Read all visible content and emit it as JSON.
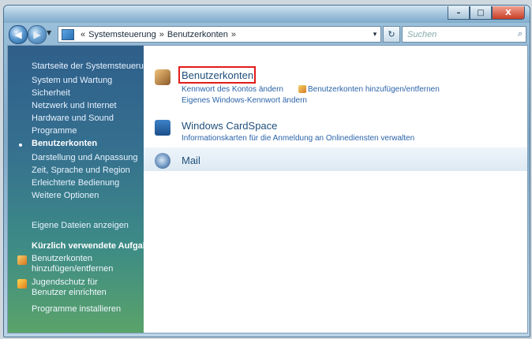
{
  "window": {
    "controls": {
      "minimize": "–",
      "maximize": "□",
      "close": "X"
    }
  },
  "address": {
    "sep1": "«",
    "crumb1": "Systemsteuerung",
    "sep2": "»",
    "crumb2": "Benutzerkonten",
    "sep3": "»",
    "dropdown": "▾",
    "refresh": "↻",
    "search_placeholder": "Suchen",
    "search_icon": "⌕"
  },
  "sidebar": {
    "top_links": [
      "Startseite der Systemsteuerung",
      "System und Wartung",
      "Sicherheit",
      "Netzwerk und Internet",
      "Hardware und Sound",
      "Programme",
      "Benutzerkonten",
      "Darstellung und Anpassung",
      "Zeit, Sprache und Region",
      "Erleichterte Bedienung",
      "Weitere Optionen"
    ],
    "active_index": 6,
    "recent_label": "Kürzlich verwendete Aufgaben",
    "tasks": [
      {
        "text": "Benutzerkonten hinzufügen/entfernen",
        "icon": "shield-icon"
      },
      {
        "text": "Jugendschutz für Benutzer einrichten",
        "icon": "shield-icon"
      },
      {
        "text": "Programme installieren",
        "icon": "none"
      }
    ],
    "search_label": "Eigene Dateien anzeigen"
  },
  "main": {
    "items": [
      {
        "title": "Benutzerkonten",
        "icon": "users-icon",
        "sub1": "Kennwort des Kontos ändern",
        "sub1b": "Benutzerkonten hinzufügen/entfernen",
        "sub2": "Eigenes Windows-Kennwort ändern"
      },
      {
        "title": "Windows CardSpace",
        "icon": "cardspace-icon",
        "sub1": "Informationskarten für die Anmeldung an Onlinediensten verwalten"
      },
      {
        "title": "Mail",
        "icon": "mail-icon"
      }
    ]
  },
  "colors": {
    "highlight": "#e31b1b",
    "link": "#2b63a8",
    "title": "#1f4f7a"
  }
}
